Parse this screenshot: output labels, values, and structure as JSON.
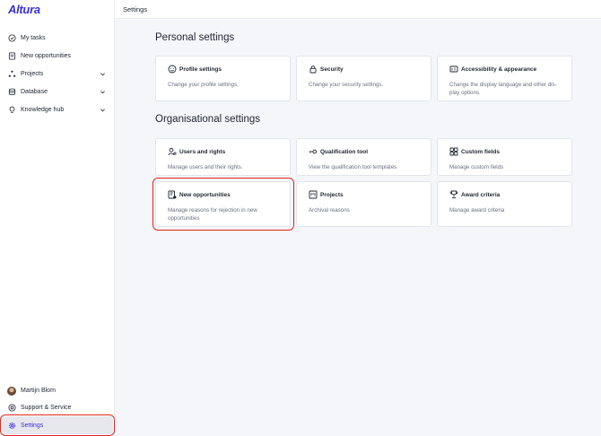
{
  "app": {
    "logo": "Altura"
  },
  "topbar": {
    "title": "Settings"
  },
  "sidebar": {
    "items": [
      {
        "label": "My tasks"
      },
      {
        "label": "New opportunities"
      },
      {
        "label": "Projects"
      },
      {
        "label": "Database"
      },
      {
        "label": "Knowledge hub"
      }
    ],
    "user": {
      "name": "Martijn Blom"
    },
    "support": {
      "label": "Support & Service"
    },
    "settings": {
      "label": "Settings"
    }
  },
  "personal": {
    "title": "Personal settings",
    "cards": [
      {
        "title": "Profile settings",
        "desc": "Change your profile settings."
      },
      {
        "title": "Security",
        "desc": "Change your security settings."
      },
      {
        "title": "Accessibility & appearance",
        "desc": "Change the display language and other dis-play options."
      }
    ]
  },
  "organisational": {
    "title": "Organisational settings",
    "cards": [
      {
        "title": "Users and rights",
        "desc": "Manage users and their rights."
      },
      {
        "title": "Qualification tool",
        "desc": "View the qualification tool templates"
      },
      {
        "title": "Custom fields",
        "desc": "Manage custom fields"
      },
      {
        "title": "New opportunities",
        "desc": "Manage reasons for rejection in new opportunities"
      },
      {
        "title": "Projects",
        "desc": "Archival reasons"
      },
      {
        "title": "Award criteria",
        "desc": "Manage award criteria"
      }
    ]
  },
  "colors": {
    "accent": "#3b2fd6",
    "highlight": "#e0261c",
    "background": "#f5f6fa"
  }
}
